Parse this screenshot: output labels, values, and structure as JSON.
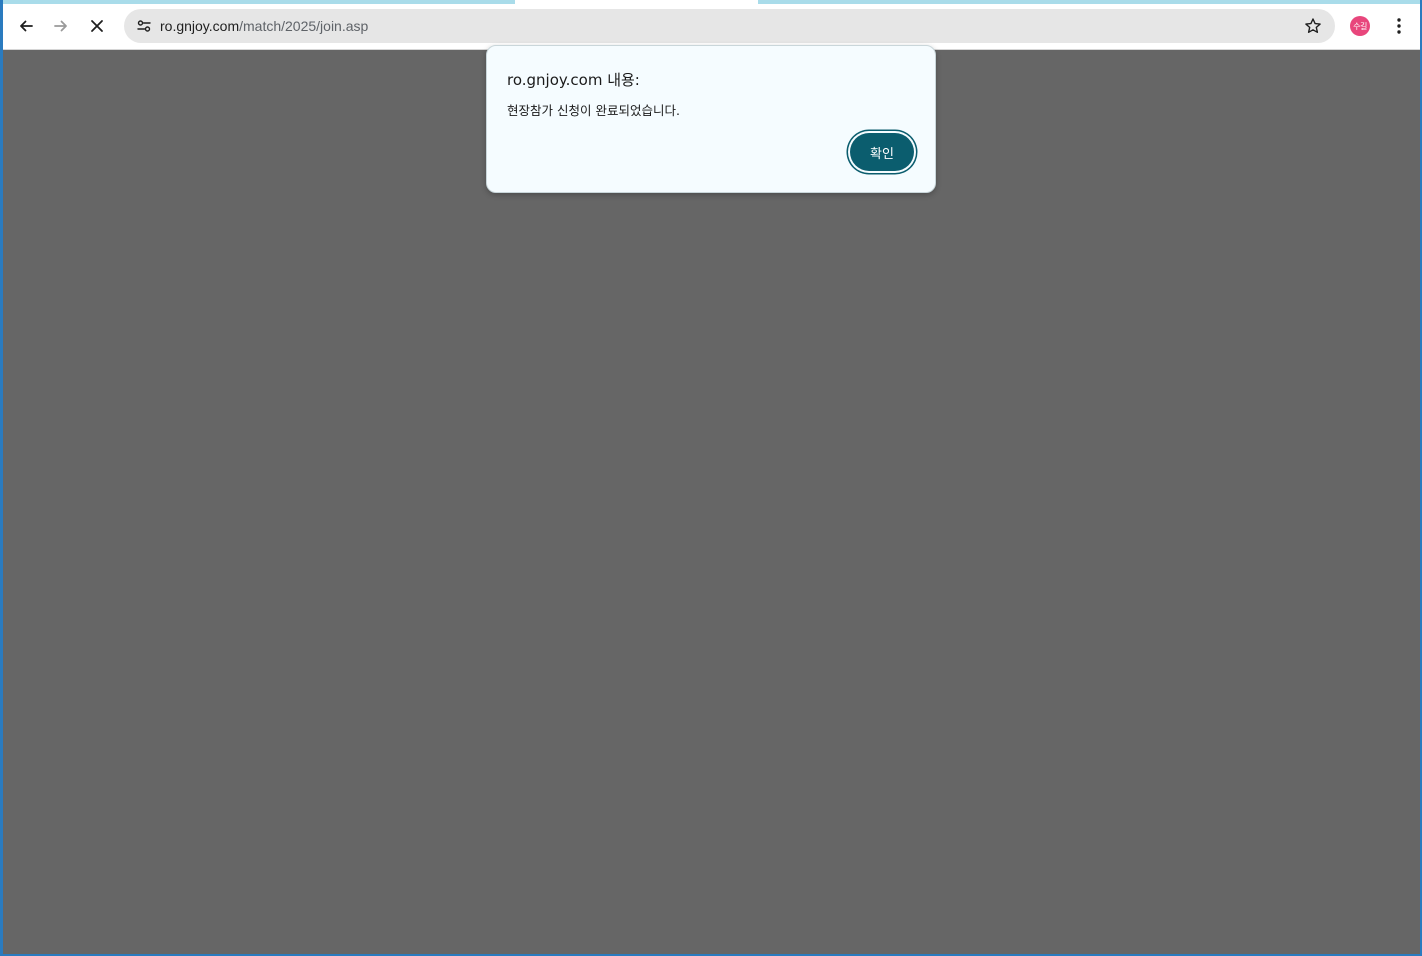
{
  "browser": {
    "url_host": "ro.gnjoy.com",
    "url_path": "/match/2025/join.asp",
    "profile_initials": "수길",
    "profile_color": "#e8467c",
    "icons": {
      "back": "arrow-left-icon",
      "forward": "arrow-right-icon",
      "stop": "close-icon",
      "site_info": "tune-icon",
      "bookmark": "star-icon",
      "menu": "kebab-menu-icon"
    }
  },
  "dialog": {
    "title": "ro.gnjoy.com 내용:",
    "message": "현장참가 신청이 완료되었습니다.",
    "ok_label": "확인",
    "accent_color": "#0b5d6e"
  }
}
